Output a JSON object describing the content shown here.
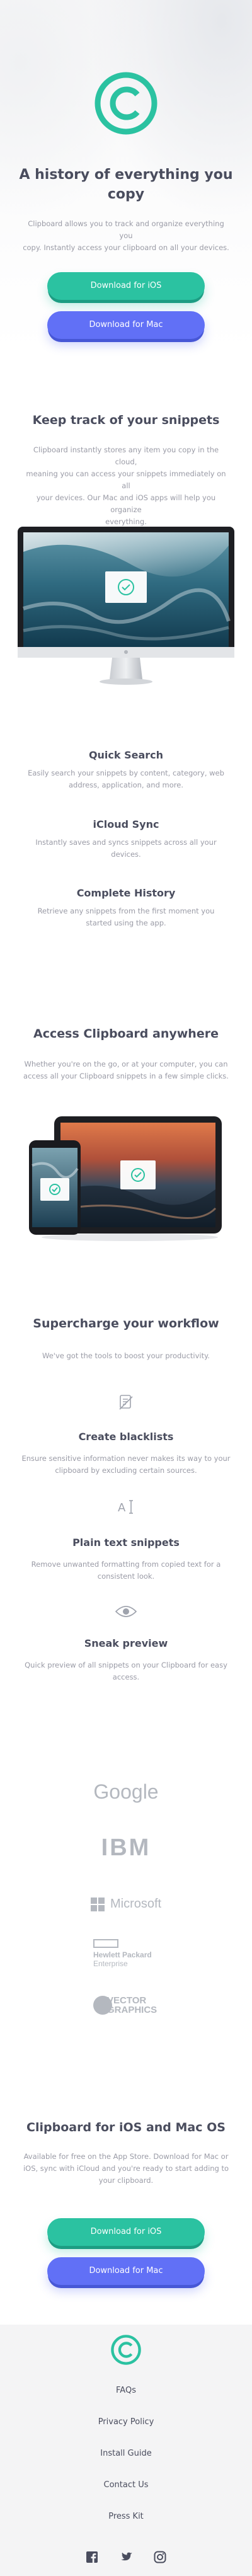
{
  "hero": {
    "title_line1": "A history of everything you",
    "title_line2": "copy",
    "description_line1": "Clipboard allows you to track and organize everything you",
    "description_line2": "copy. Instantly access your clipboard on all your devices.",
    "ios_button": "Download for iOS",
    "mac_button": "Download for Mac"
  },
  "snippets": {
    "title": "Keep track of your snippets",
    "description_line1": "Clipboard instantly stores any item you copy in the cloud,",
    "description_line2": "meaning you can access your snippets immediately on all",
    "description_line3": "your devices. Our Mac and iOS apps will help you organize",
    "description_line4": "everything."
  },
  "features": [
    {
      "title": "Quick Search",
      "line1": "Easily search your snippets by content, category, web",
      "line2": "address, application, and more."
    },
    {
      "title": "iCloud Sync",
      "line1": "Instantly saves and syncs snippets across all your",
      "line2": "devices."
    },
    {
      "title": "Complete History",
      "line1": "Retrieve any snippets from the first moment you",
      "line2": "started using the app."
    }
  ],
  "access": {
    "title": "Access Clipboard anywhere",
    "description_line1": "Whether you're on the go, or at your computer, you can",
    "description_line2": "access all your Clipboard snippets in a few simple clicks."
  },
  "workflow": {
    "title": "Supercharge your workflow",
    "subtitle": "We've got the tools to boost your productivity.",
    "items": [
      {
        "icon": "blacklist-icon",
        "title": "Create blacklists",
        "line1": "Ensure sensitive information never makes its way to your",
        "line2": "clipboard by excluding certain sources."
      },
      {
        "icon": "text-cursor-icon",
        "title": "Plain text snippets",
        "line1": "Remove unwanted formatting from copied text for a",
        "line2": "consistent look."
      },
      {
        "icon": "eye-icon",
        "title": "Sneak preview",
        "line1": "Quick preview of all snippets on your Clipboard for easy",
        "line2": "access."
      }
    ]
  },
  "partners": {
    "google": "Google",
    "ibm": "IBM",
    "microsoft": "Microsoft",
    "hpe_line1": "Hewlett Packard",
    "hpe_line2": "Enterprise",
    "vector_line1": "VECTOR",
    "vector_line2": "GRAPHICS"
  },
  "cta": {
    "title": "Clipboard for iOS and Mac OS",
    "description_line1": "Available for free on the App Store. Download for Mac or",
    "description_line2": "iOS, sync with iCloud and you're ready to start adding to",
    "description_line3": "your clipboard.",
    "ios_button": "Download for iOS",
    "mac_button": "Download for Mac"
  },
  "footer": {
    "links": [
      "FAQs",
      "Privacy Policy",
      "Install Guide",
      "Contact Us",
      "Press Kit"
    ],
    "social": [
      "facebook-icon",
      "twitter-icon",
      "instagram-icon"
    ]
  },
  "colors": {
    "accent_green": "#2bc2a1",
    "accent_blue": "#6170f6",
    "heading": "#4a4d5e",
    "body_text": "#9a9ba6"
  }
}
